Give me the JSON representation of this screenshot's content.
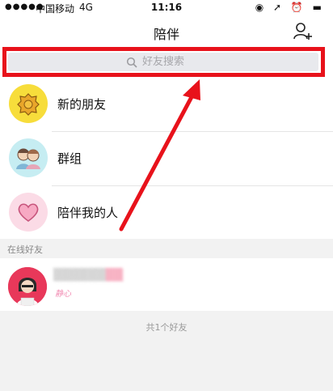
{
  "status_bar": {
    "signal": "●●●●●",
    "carrier": "中国移动",
    "network": "4G",
    "time": "11:16",
    "right_icons": "◉ ➚ ⏰ ▬"
  },
  "nav": {
    "title": "陪伴",
    "add_friend_icon": "add-person-icon"
  },
  "search": {
    "placeholder": "好友搜索",
    "icon": "search-icon"
  },
  "menu_items": [
    {
      "label": "新的朋友",
      "icon": "new-friend-icon",
      "color": "#f7dd3b"
    },
    {
      "label": "群组",
      "icon": "group-icon",
      "color": "#c6edf2"
    },
    {
      "label": "陪伴我的人",
      "icon": "heart-icon",
      "color": "#fbdbe6"
    }
  ],
  "online_section": {
    "title": "在线好友"
  },
  "friend": {
    "name_blurred": "▒▒▒▒▒▒",
    "name_tail": "▒▒",
    "status": "静心"
  },
  "footer": {
    "count_text": "共1个好友"
  },
  "colors": {
    "annotation_red": "#e8121b",
    "search_bg": "#e8e9ed",
    "section_bg": "#f2f2f2"
  }
}
